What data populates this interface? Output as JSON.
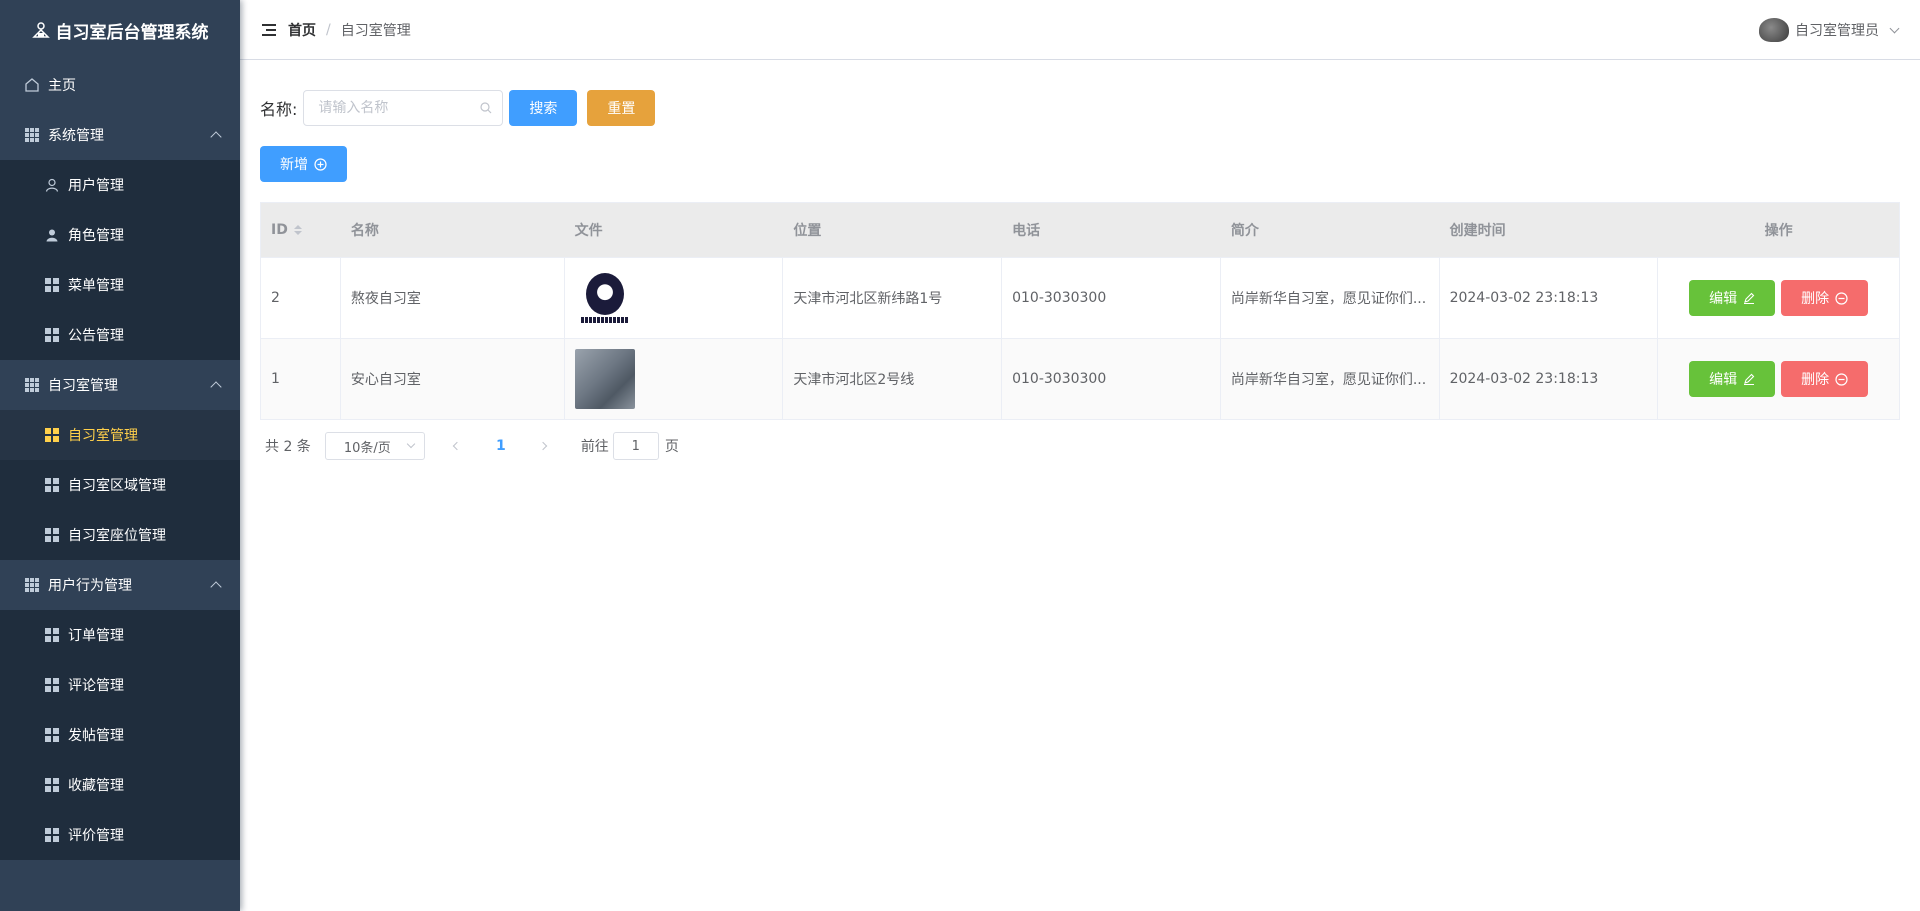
{
  "app": {
    "title": "自习室后台管理系统"
  },
  "sidebar": {
    "home": "主页",
    "groups": [
      {
        "label": "系统管理",
        "items": [
          "用户管理",
          "角色管理",
          "菜单管理",
          "公告管理"
        ]
      },
      {
        "label": "自习室管理",
        "items": [
          "自习室管理",
          "自习室区域管理",
          "自习室座位管理"
        ],
        "active_index": 0
      },
      {
        "label": "用户行为管理",
        "items": [
          "订单管理",
          "评论管理",
          "发帖管理",
          "收藏管理",
          "评价管理"
        ]
      }
    ],
    "active_color": "#ffd04b",
    "bg_color": "#304156"
  },
  "header": {
    "breadcrumb_home": "首页",
    "breadcrumb_sep": "/",
    "breadcrumb_current": "自习室管理",
    "username": "自习室管理员"
  },
  "search": {
    "label": "名称:",
    "placeholder": "请输入名称",
    "search_btn": "搜索",
    "reset_btn": "重置"
  },
  "toolbar": {
    "add_btn": "新增"
  },
  "table": {
    "columns": [
      "ID",
      "名称",
      "文件",
      "位置",
      "电话",
      "简介",
      "创建时间",
      "操作"
    ],
    "rows": [
      {
        "id": "2",
        "name": "熬夜自习室",
        "file": "logo-image",
        "location": "天津市河北区新纬路1号",
        "phone": "010-3030300",
        "intro": "尚岸新华自习室，愿见证你们...",
        "created": "2024-03-02 23:18:13"
      },
      {
        "id": "1",
        "name": "安心自习室",
        "file": "photo-image",
        "location": "天津市河北区2号线",
        "phone": "010-3030300",
        "intro": "尚岸新华自习室，愿见证你们...",
        "created": "2024-03-02 23:18:13"
      }
    ],
    "edit_btn": "编辑",
    "delete_btn": "删除"
  },
  "pagination": {
    "total_text": "共 2 条",
    "page_size": "10条/页",
    "current_page": "1",
    "goto_label": "前往",
    "goto_value": "1",
    "page_suffix": "页"
  },
  "colors": {
    "primary": "#409eff",
    "warning": "#e6a23c",
    "success": "#67c23a",
    "danger": "#f56c6c"
  }
}
